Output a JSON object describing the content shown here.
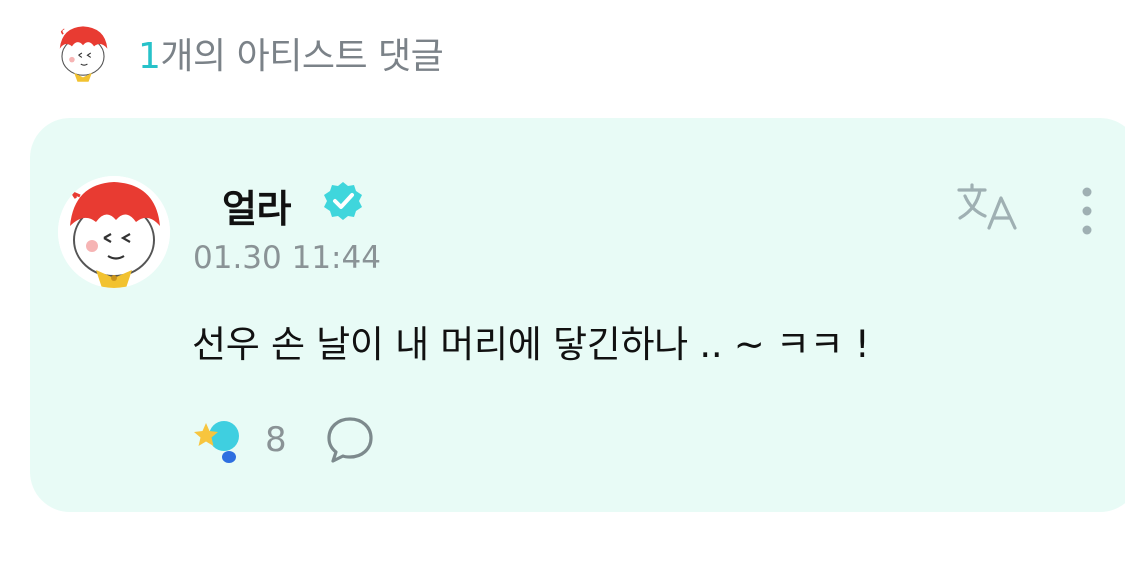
{
  "header": {
    "count": "1",
    "title_rest": "개의 아티스트 댓글"
  },
  "comment": {
    "author": "얼라",
    "timestamp": "01.30 11:44",
    "text": "선우 손 날이 내 머리에 닿긴하나 .. ~ ㅋㅋ !",
    "like_count": "8"
  },
  "icons": {
    "header_avatar": "artist-avatar-drawing",
    "avatar": "artist-avatar-drawing",
    "verified": "verified-badge-icon",
    "translate": "translate-icon",
    "more": "more-vertical-icon",
    "like": "star-lightstick-icon",
    "reply": "speech-bubble-icon"
  },
  "colors": {
    "accent": "#27c2c9",
    "card_bg": "#e8fbf6",
    "muted": "#8a9396",
    "hair": "#e83b32"
  }
}
